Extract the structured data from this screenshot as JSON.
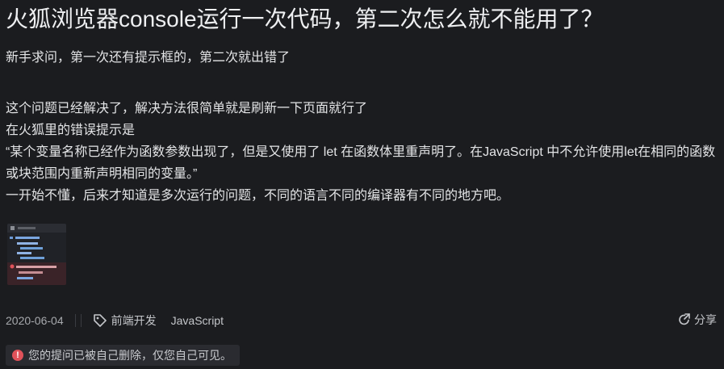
{
  "question": {
    "title": "火狐浏览器console运行一次代码，第二次怎么就不能用了？",
    "paragraphs": [
      "新手求问，第一次还有提示框的，第二次就出错了",
      "这个问题已经解决了，解决方法很简单就是刷新一下页面就行了",
      "在火狐里的错误提示是",
      "“某个变量名称已经作为函数参数出现了，但是又使用了 let 在函数体里重声明了。在JavaScript 中不允许使用let在相同的函数或块范围内重新声明相同的变量。”",
      "一开始不懂，后来才知道是多次运行的问题，不同的语言不同的编译器有不同的地方吧。"
    ]
  },
  "meta": {
    "date": "2020-06-04",
    "tags": [
      "前端开发",
      "JavaScript"
    ],
    "share_label": "分享"
  },
  "notice": {
    "icon": "warning-circle-icon",
    "text": "您的提问已被自己删除，仅您自己可见。",
    "color": "#e0525a"
  }
}
